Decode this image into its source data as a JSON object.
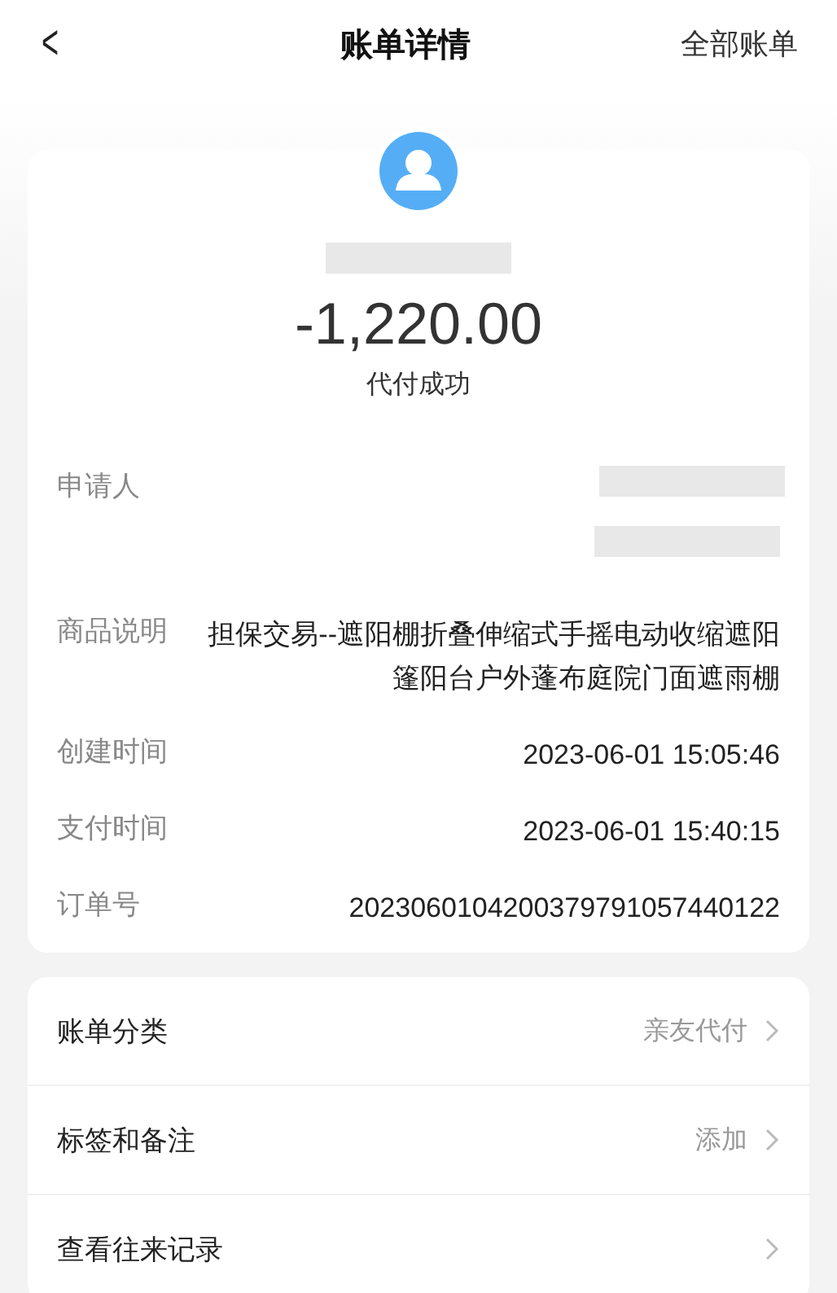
{
  "header": {
    "back": "<",
    "title": "账单详情",
    "action": "全部账单"
  },
  "summary": {
    "amount": "-1,220.00",
    "status": "代付成功"
  },
  "details": [
    {
      "kind": "redacted",
      "label": "申请人"
    },
    {
      "kind": "text",
      "label": "商品说明",
      "value": "担保交易--遮阳棚折叠伸缩式手摇电动收缩遮阳篷阳台户外蓬布庭院门面遮雨棚"
    },
    {
      "kind": "text",
      "label": "创建时间",
      "value": "2023-06-01 15:05:46"
    },
    {
      "kind": "text",
      "label": "支付时间",
      "value": "2023-06-01 15:40:15"
    },
    {
      "kind": "text",
      "label": "订单号",
      "value": "2023060104200379791057440122"
    }
  ],
  "menu": [
    {
      "label": "账单分类",
      "value": "亲友代付"
    },
    {
      "label": "标签和备注",
      "value": "添加"
    },
    {
      "label": "查看往来记录"
    }
  ]
}
